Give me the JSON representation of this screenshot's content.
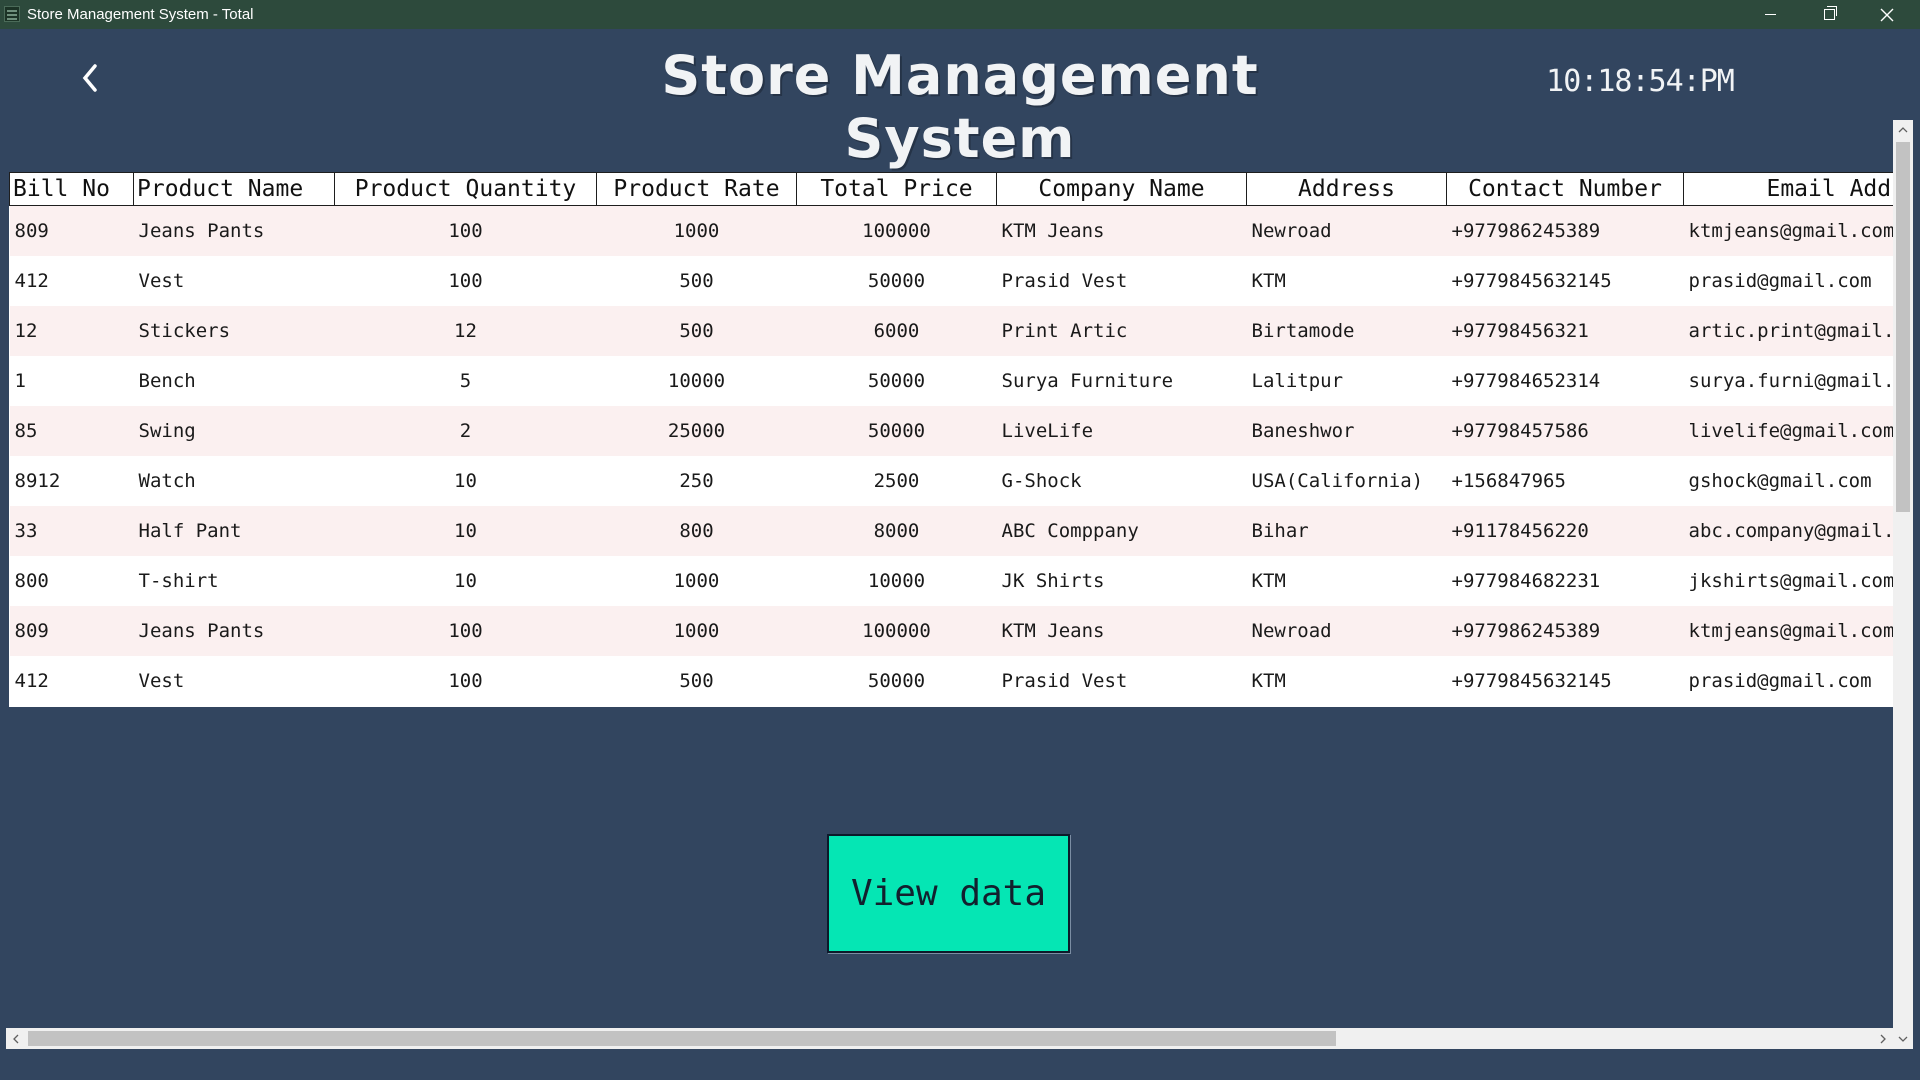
{
  "window": {
    "title": "Store Management System - Total",
    "icon": "app-window-icon"
  },
  "header": {
    "back_icon": "chevron-left-icon",
    "title": "Store Management System",
    "clock": "10:18:54:PM"
  },
  "table": {
    "columns": [
      "Bill No",
      "Product Name",
      "Product Quantity",
      "Product Rate",
      "Total Price",
      "Company Name",
      "Address",
      "Contact Number",
      "Email Address"
    ],
    "rows": [
      [
        "809",
        "Jeans Pants",
        "100",
        "1000",
        "100000",
        "KTM Jeans",
        "Newroad",
        "+977986245389",
        "ktmjeans@gmail.com"
      ],
      [
        "412",
        "Vest",
        "100",
        "500",
        "50000",
        "Prasid Vest",
        "KTM",
        "+9779845632145",
        "prasid@gmail.com"
      ],
      [
        "12",
        "Stickers",
        "12",
        "500",
        "6000",
        "Print Artic",
        "Birtamode",
        "+97798456321",
        "artic.print@gmail.com"
      ],
      [
        "1",
        "Bench",
        "5",
        "10000",
        "50000",
        "Surya Furniture",
        "Lalitpur",
        "+977984652314",
        "surya.furni@gmail.com"
      ],
      [
        "85",
        "Swing",
        "2",
        "25000",
        "50000",
        "LiveLife",
        "Baneshwor",
        "+97798457586",
        "livelife@gmail.com"
      ],
      [
        "8912",
        "Watch",
        "10",
        "250",
        "2500",
        "G-Shock",
        "USA(California)",
        "+156847965",
        "gshock@gmail.com"
      ],
      [
        "33",
        "Half Pant",
        "10",
        "800",
        "8000",
        "ABC Comppany",
        "Bihar",
        "+91178456220",
        "abc.company@gmail.com"
      ],
      [
        "800",
        "T-shirt",
        "10",
        "1000",
        "10000",
        "JK Shirts",
        "KTM",
        "+977984682231",
        "jkshirts@gmail.com"
      ],
      [
        "809",
        "Jeans Pants",
        "100",
        "1000",
        "100000",
        "KTM Jeans",
        "Newroad",
        "+977986245389",
        "ktmjeans@gmail.com"
      ],
      [
        "412",
        "Vest",
        "100",
        "500",
        "50000",
        "Prasid Vest",
        "KTM",
        "+9779845632145",
        "prasid@gmail.com"
      ]
    ]
  },
  "actions": {
    "view_data_label": "View data"
  },
  "colors": {
    "background": "#32455f",
    "titlebar": "#2d4a3c",
    "button": "#05e6b4",
    "row_alt": "#fbf0f0"
  }
}
